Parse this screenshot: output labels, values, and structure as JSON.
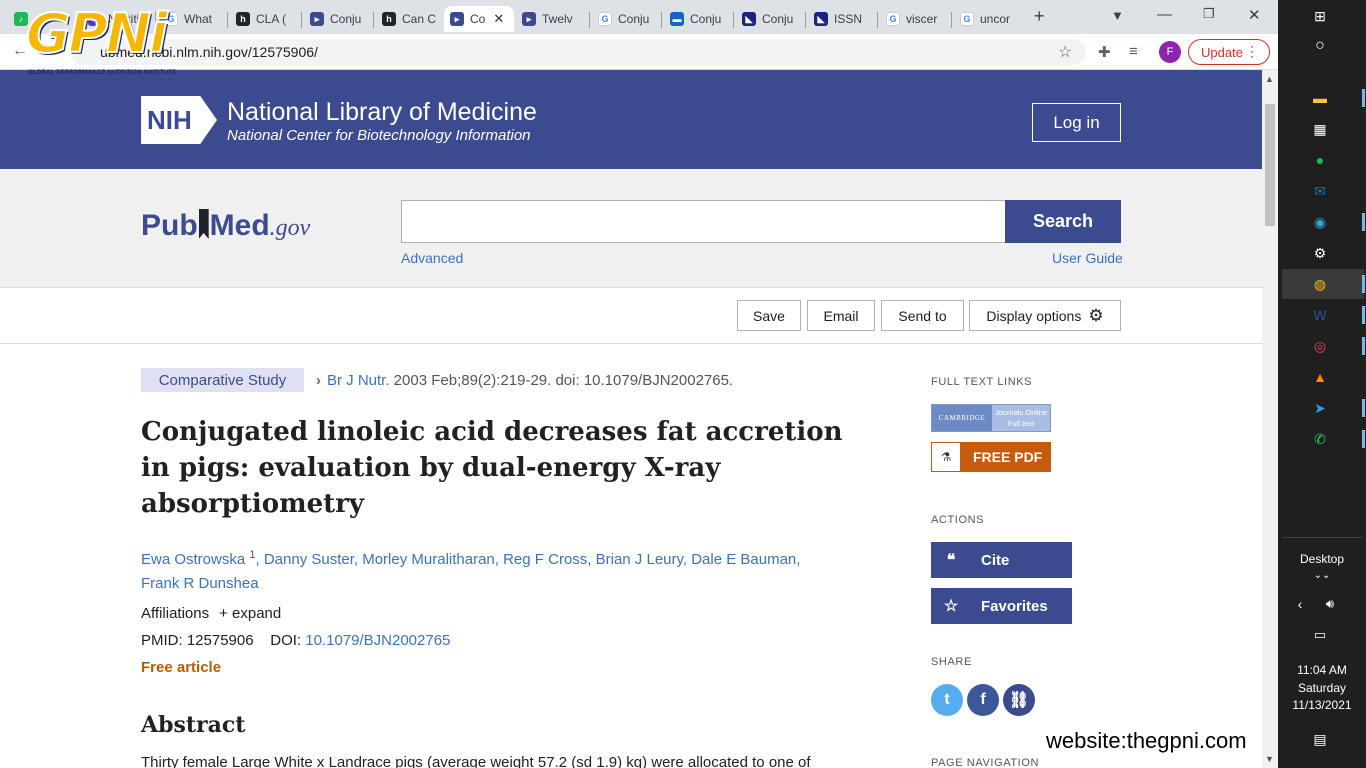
{
  "browser": {
    "tabs": [
      {
        "label": "",
        "color": "#1db954"
      },
      {
        "label": "Nutriti",
        "color": "#5f2ee5"
      },
      {
        "label": "What",
        "color": "#4285f4"
      },
      {
        "label": "CLA (",
        "color": "#222222"
      },
      {
        "label": "Conju",
        "color": "#3c4a8f"
      },
      {
        "label": "Can C",
        "color": "#222222"
      },
      {
        "label": "Co",
        "color": "#3c4a8f"
      },
      {
        "label": "Twelv",
        "color": "#3c4a8f"
      },
      {
        "label": "Conju",
        "color": "#4285f4"
      },
      {
        "label": "Conju",
        "color": "#1565c0"
      },
      {
        "label": "Conju",
        "color": "#1a237e"
      },
      {
        "label": "ISSN",
        "color": "#1a237e"
      },
      {
        "label": "viscer",
        "color": "#4285f4"
      },
      {
        "label": "uncor",
        "color": "#4285f4"
      }
    ],
    "url": "ubmed.ncbi.nlm.nih.gov/12575906/",
    "profile_initial": "F",
    "update_label": "Update"
  },
  "watermark": {
    "brand": "GPNi",
    "tagline": "GLOBAL PERFORMANCE NUTRITION INSTITUTE",
    "website": "website:thegpni.com"
  },
  "nlm": {
    "logo": "NIH",
    "title": "National Library of Medicine",
    "subtitle": "National Center for Biotechnology Information",
    "login": "Log in"
  },
  "pubmed": {
    "logo_pre": "Pub",
    "logo_post": "Med",
    "logo_gov": ".gov",
    "search_button": "Search",
    "search_value": "",
    "advanced": "Advanced",
    "user_guide": "User Guide"
  },
  "actions": {
    "save": "Save",
    "email": "Email",
    "send_to": "Send to",
    "display_options": "Display options"
  },
  "article": {
    "type": "Comparative Study",
    "journal": "Br J Nutr.",
    "citation": " 2003 Feb;89(2):219-29. doi: 10.1079/BJN2002765.",
    "title": "Conjugated linoleic acid decreases fat accretion in pigs: evaluation by dual-energy X-ray absorptiometry",
    "first_author": "Ewa Ostrowska",
    "affil_num": "1",
    "other_authors": ", Danny Suster, Morley Muralitharan, Reg F Cross, Brian J Leury, Dale E Bauman, Frank R Dunshea",
    "affiliations": "Affiliations",
    "expand": "expand",
    "pmid_label": "PMID: 12575906",
    "doi_label": "DOI:",
    "doi": "10.1079/BJN2002765",
    "free": "Free article",
    "abstract_heading": "Abstract",
    "abstract_text": "Thirty female Large White x Landrace pigs (average weight 57.2 (sd 1.9) kg) were allocated to one of"
  },
  "sidebar": {
    "full_text_links": "FULL TEXT LINKS",
    "cambridge_left": "CAMBRIDGE",
    "cambridge_right1": "Journals Online",
    "cambridge_right2": "Full text",
    "free_pdf": "FREE PDF",
    "actions_heading": "ACTIONS",
    "cite": "Cite",
    "favorites": "Favorites",
    "share_heading": "SHARE",
    "page_nav": "PAGE NAVIGATION"
  },
  "taskbar": {
    "desktop": "Desktop",
    "time": "11:04 AM",
    "day": "Saturday",
    "date": "11/13/2021"
  },
  "colors": {
    "nlm_blue": "#3c4a8f",
    "link": "#3c73b8",
    "free_orange": "#b35e00",
    "pdf_orange": "#c65a0d"
  }
}
